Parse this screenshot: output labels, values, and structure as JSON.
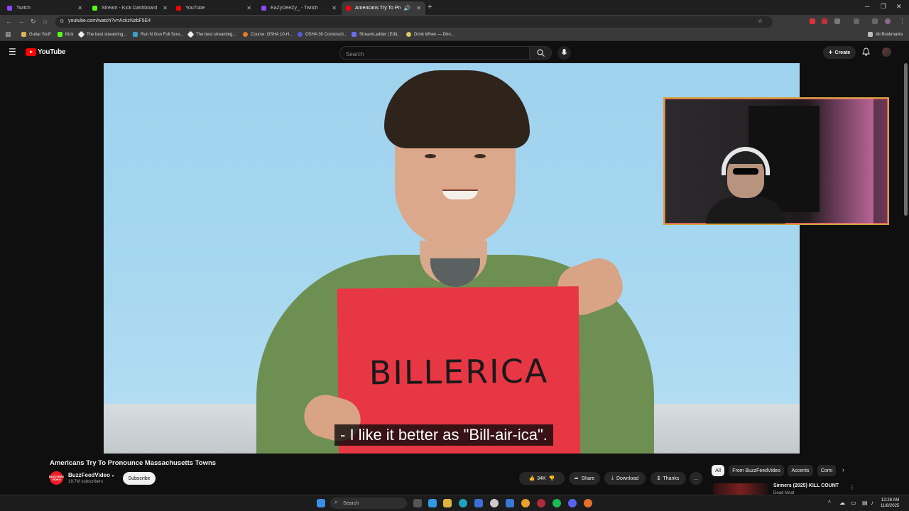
{
  "browser": {
    "tabs": [
      {
        "title": "Twitch",
        "color": "#9146ff"
      },
      {
        "title": "Stream - Kick Dashboard",
        "color": "#53fc18"
      },
      {
        "title": "YouTube",
        "color": "#ff0000"
      },
      {
        "title": "EaZyDeeZy_ - Twitch",
        "color": "#9146ff"
      },
      {
        "title": "Americans Try To Pronounce",
        "color": "#ff0000"
      }
    ],
    "url": "youtube.com/watch?v=AckzNzbF5E4",
    "bookmarks": [
      "Guitar Stuff",
      "Kick",
      "The best streaming...",
      "Run N Gun Full Scre...",
      "The best streaming...",
      "Course: OSHA 10-H...",
      "OSHA 30 Constructi...",
      "StreamLadder | Edit...",
      "Drink When — Drin..."
    ],
    "all_bookmarks": "All Bookmarks"
  },
  "youtube": {
    "logo": "YouTube",
    "search_placeholder": "Search",
    "create_label": "Create"
  },
  "video": {
    "sign_text": "BILLERICA",
    "caption": "- I like it better as \"Bill-air-ica\".",
    "title": "Americans Try To Pronounce Massachusetts Towns",
    "channel_avatar_text": "BUZZFEED VIDEO",
    "channel": "BuzzFeedVideo",
    "subscribers": "19.7M subscribers",
    "subscribe_label": "Subscribe",
    "likes": "34K",
    "share_label": "Share",
    "download_label": "Download",
    "thanks_label": "Thanks",
    "more_label": "..."
  },
  "sidebar_chips": [
    "All",
    "From BuzzFeedVideo",
    "Accents",
    "Comi"
  ],
  "recommendation": {
    "title": "Sinners (2025) KILL COUNT",
    "channel": "Dead Meat"
  },
  "taskbar": {
    "search_placeholder": "Search",
    "time": "12:28 AM",
    "date": "11/8/2025"
  }
}
